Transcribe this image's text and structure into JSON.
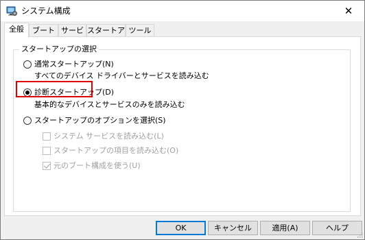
{
  "window": {
    "title": "システム構成",
    "icon": "msconfig-icon",
    "close_glyph": "✕"
  },
  "tabs": [
    {
      "label": "全般",
      "active": true
    },
    {
      "label": "ブート",
      "active": false
    },
    {
      "label": "サービス",
      "active": false
    },
    {
      "label": "スタートアップ",
      "active": false
    },
    {
      "label": "ツール",
      "active": false
    }
  ],
  "group": {
    "label": "スタートアップの選択"
  },
  "options": {
    "normal": {
      "label": "通常スタートアップ(N)",
      "description": "すべてのデバイス ドライバーとサービスを読み込む",
      "selected": false
    },
    "diagnostic": {
      "label": "診断スタートアップ(D)",
      "description": "基本的なデバイスとサービスのみを読み込む",
      "selected": true
    },
    "selective": {
      "label": "スタートアップのオプションを選択(S)",
      "selected": false
    }
  },
  "checkboxes": {
    "system_services": {
      "label": "システム サービスを読み込む(L)",
      "checked": false
    },
    "startup_items": {
      "label": "スタートアップの項目を読み込む(O)",
      "checked": false
    },
    "original_boot": {
      "label": "元のブート構成を使う(U)",
      "checked": true
    }
  },
  "buttons": {
    "ok": "OK",
    "cancel": "キャンセル",
    "apply": "適用(A)",
    "help": "ヘルプ"
  },
  "colors": {
    "highlight": "#e00000",
    "accent": "#0078d7"
  }
}
